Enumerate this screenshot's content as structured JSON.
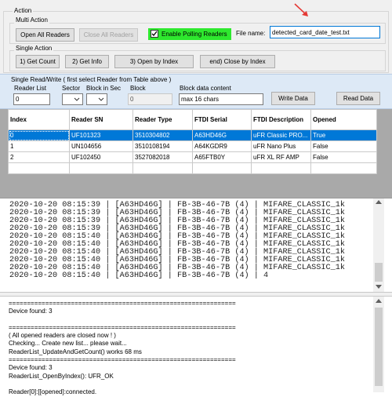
{
  "action_section": {
    "title": "Action",
    "multi_action": {
      "title": "Multi Action",
      "open_all_readers": "Open All Readers",
      "close_all_readers": "Close All Readers",
      "enable_polling_label": "Enable Polling Readers",
      "enable_polling_checked": true,
      "file_name_label": "File name:",
      "file_name_value": "detected_card_date_test.txt"
    },
    "single_action": {
      "title": "Single Action",
      "get_count": "1) Get Count",
      "get_info": "2) Get Info",
      "open_by_index": "3) Open by Index",
      "close_by_index": "end) Close by Index"
    }
  },
  "single_rw": {
    "title": "Single Read/Write  ( first select Reader from Table above )",
    "reader_list_label": "Reader List",
    "reader_list_value": "0",
    "sector_label": "Sector",
    "block_in_sec_label": "Block in Sec",
    "block_label": "Block",
    "block_value": "0",
    "block_data_label": "Block data content",
    "block_data_value": "max 16 chars",
    "write_data": "Write Data",
    "read_data": "Read Data"
  },
  "reader_table": {
    "columns": [
      "Index",
      "Reader SN",
      "Reader Type",
      "FTDI Serial",
      "FTDI Description",
      "Opened"
    ],
    "rows": [
      [
        "0",
        "UF101323",
        "3510304802",
        "A63HD46G",
        "uFR Classic PRO...",
        "True"
      ],
      [
        "1",
        "UN104656",
        "3510108194",
        "A64KGDR9",
        "uFR Nano Plus",
        "False"
      ],
      [
        "2",
        "UF102450",
        "3527082018",
        "A65FTB0Y",
        "uFR XL RF AMP",
        "False"
      ]
    ],
    "selected_row": 0
  },
  "card_log": [
    "2020-10-20 08:15:39 | [A63HD46G] | FB-3B-46-7B (4) | MIFARE_CLASSIC_1k",
    "2020-10-20 08:15:39 | [A63HD46G] | FB-3B-46-7B (4) | MIFARE_CLASSIC_1k",
    "2020-10-20 08:15:39 | [A63HD46G] | FB-3B-46-7B (4) | MIFARE_CLASSIC_1k",
    "2020-10-20 08:15:39 | [A63HD46G] | FB-3B-46-7B (4) | MIFARE_CLASSIC_1k",
    "2020-10-20 08:15:40 | [A63HD46G] | FB-3B-46-7B (4) | MIFARE_CLASSIC_1k",
    "2020-10-20 08:15:40 | [A63HD46G] | FB-3B-46-7B (4) | MIFARE_CLASSIC_1k",
    "2020-10-20 08:15:40 | [A63HD46G] | FB-3B-46-7B (4) | MIFARE_CLASSIC_1k",
    "2020-10-20 08:15:40 | [A63HD46G] | FB-3B-46-7B (4) | MIFARE_CLASSIC_1k",
    "2020-10-20 08:15:40 | [A63HD46G] | FB-3B-46-7B (4) | MIFARE_CLASSIC_1k",
    "2020-10-20 08:15:40 | [A63HD46G] | FB-3B-46-7B (4) | 4"
  ],
  "status_log": [
    "==============================================================",
    "Device found: 3",
    "",
    "==============================================================",
    "( All opened readers are closed now ! )",
    "Checking... Create new list... please wait...",
    "ReaderList_UpdateAndGetCount() works 68 ms",
    "==============================================================",
    "Device found: 3",
    "ReaderList_OpenByIndex(): UFR_OK",
    "",
    "Reader[0]:[[opened]:connected."
  ],
  "colors": {
    "accent": "#0078d7",
    "polling_highlight": "#2ee82e",
    "annotation_arrow": "#e53935",
    "panel_bg": "#f0f0f0",
    "rw_panel_bg": "#dde9f6"
  }
}
